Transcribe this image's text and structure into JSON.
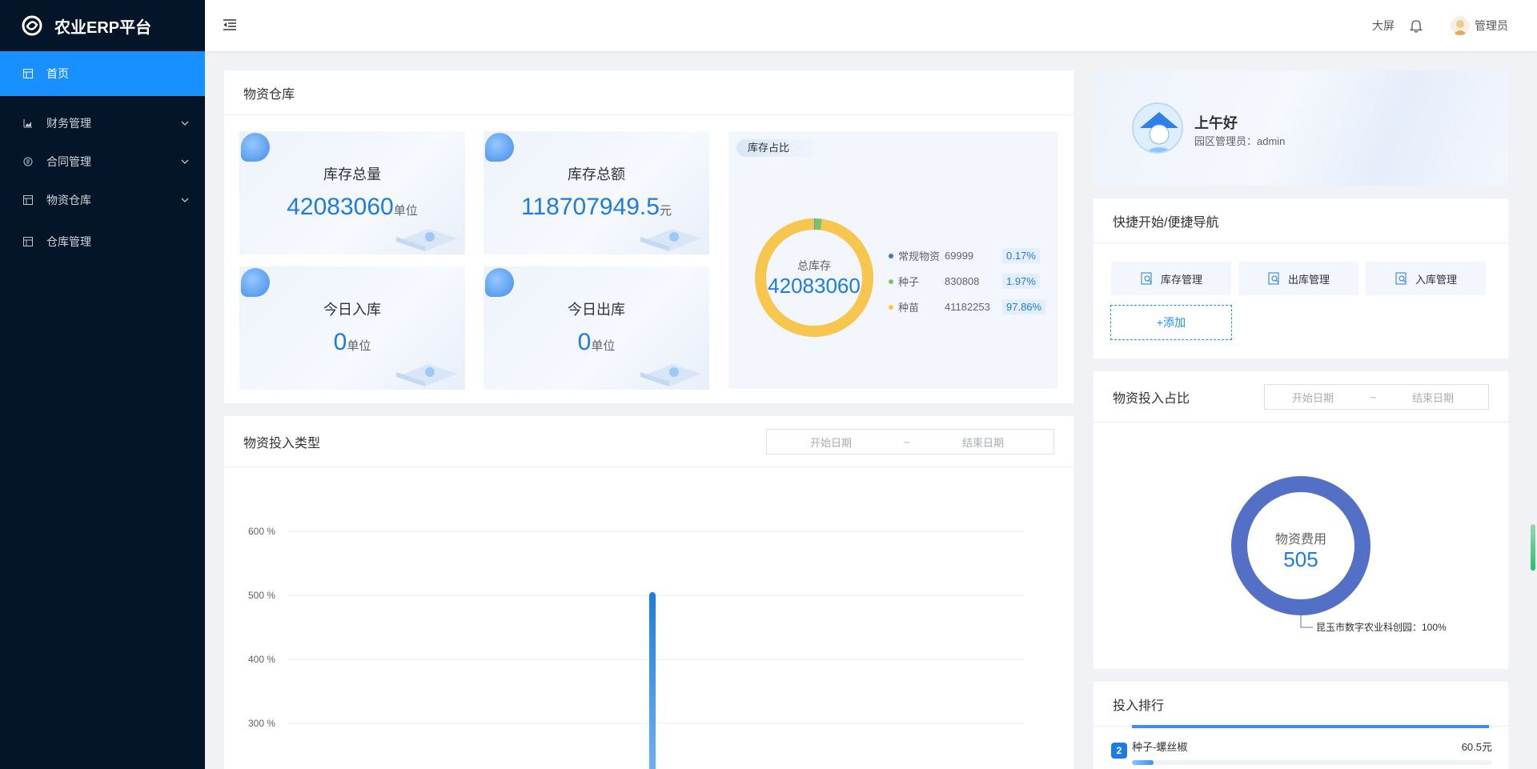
{
  "app": {
    "title": "农业ERP平台"
  },
  "sidebar": {
    "items": [
      {
        "label": "首页",
        "icon": "grid-icon",
        "active": true,
        "expandable": false
      },
      {
        "label": "财务管理",
        "icon": "chart-icon",
        "active": false,
        "expandable": true
      },
      {
        "label": "合同管理",
        "icon": "contract-icon",
        "active": false,
        "expandable": true
      },
      {
        "label": "物资仓库",
        "icon": "grid-icon",
        "active": false,
        "expandable": true
      },
      {
        "label": "仓库管理",
        "icon": "grid-icon",
        "active": false,
        "expandable": false
      }
    ]
  },
  "header": {
    "big_screen": "大屏",
    "user": "管理员"
  },
  "warehouse": {
    "title": "物资仓库",
    "stats": [
      {
        "label": "库存总量",
        "value": "42083060",
        "unit": "单位"
      },
      {
        "label": "库存总额",
        "value": "118707949.5",
        "unit": "元"
      },
      {
        "label": "今日入库",
        "value": "0",
        "unit": "单位"
      },
      {
        "label": "今日出库",
        "value": "0",
        "unit": "单位"
      }
    ],
    "ratio": {
      "tag": "库存占比",
      "center_label": "总库存",
      "center_value": "42083060",
      "legend": [
        {
          "name": "常规物资",
          "value": "69999",
          "pct": "0.17%",
          "color": "#4a6fd1"
        },
        {
          "name": "种子",
          "value": "830808",
          "pct": "1.97%",
          "color": "#7cc06a"
        },
        {
          "name": "种苗",
          "value": "41182253",
          "pct": "97.86%",
          "color": "#f7c64e"
        }
      ]
    }
  },
  "chart_data": {
    "type": "bar",
    "title": "物资投入类型",
    "y_ticks": [
      "600 %",
      "500 %",
      "400 %",
      "300 %"
    ],
    "ylim": [
      0,
      600
    ],
    "series": [
      {
        "values": [
          505
        ]
      }
    ],
    "bar_color": "#1d7ce0"
  },
  "type_filter": {
    "start": "开始日期",
    "sep": "~",
    "end": "结束日期"
  },
  "greeting": {
    "hello": "上午好",
    "role": "园区管理员：admin"
  },
  "quick": {
    "title": "快捷开始/便捷导航",
    "buttons": [
      "库存管理",
      "出库管理",
      "入库管理"
    ],
    "add": "+添加"
  },
  "share": {
    "title": "物资投入占比",
    "filter": {
      "start": "开始日期",
      "sep": "~",
      "end": "结束日期"
    },
    "center_label": "物资费用",
    "center_value": "505",
    "slice_label": "昆玉市数字农业科创园：100%",
    "ring_color": "#5470c6"
  },
  "ranking": {
    "title": "投入排行",
    "rows": [
      {
        "rank": "2",
        "name": "种子-螺丝椒",
        "amount": "60.5元",
        "fraction": 0.06
      }
    ],
    "top_fraction": 0.99
  }
}
